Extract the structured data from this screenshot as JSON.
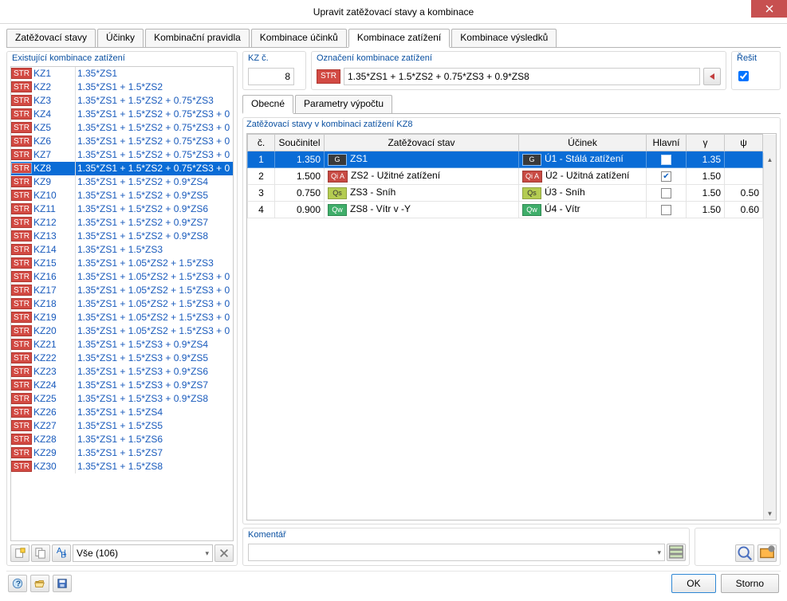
{
  "window": {
    "title": "Upravit zatěžovací stavy a kombinace"
  },
  "top_tabs": {
    "items": [
      "Zatěžovací stavy",
      "Účinky",
      "Kombinační pravidla",
      "Kombinace účinků",
      "Kombinace zatížení",
      "Kombinace výsledků"
    ],
    "active_index": 4
  },
  "left": {
    "group_label": "Existující kombinace zatížení",
    "badge_text": "STR",
    "selected_id": "KZ8",
    "combinations": [
      {
        "id": "KZ1",
        "formula": "1.35*ZS1"
      },
      {
        "id": "KZ2",
        "formula": "1.35*ZS1 + 1.5*ZS2"
      },
      {
        "id": "KZ3",
        "formula": "1.35*ZS1 + 1.5*ZS2 + 0.75*ZS3"
      },
      {
        "id": "KZ4",
        "formula": "1.35*ZS1 + 1.5*ZS2 + 0.75*ZS3 + 0"
      },
      {
        "id": "KZ5",
        "formula": "1.35*ZS1 + 1.5*ZS2 + 0.75*ZS3 + 0"
      },
      {
        "id": "KZ6",
        "formula": "1.35*ZS1 + 1.5*ZS2 + 0.75*ZS3 + 0"
      },
      {
        "id": "KZ7",
        "formula": "1.35*ZS1 + 1.5*ZS2 + 0.75*ZS3 + 0"
      },
      {
        "id": "KZ8",
        "formula": "1.35*ZS1 + 1.5*ZS2 + 0.75*ZS3 + 0"
      },
      {
        "id": "KZ9",
        "formula": "1.35*ZS1 + 1.5*ZS2 + 0.9*ZS4"
      },
      {
        "id": "KZ10",
        "formula": "1.35*ZS1 + 1.5*ZS2 + 0.9*ZS5"
      },
      {
        "id": "KZ11",
        "formula": "1.35*ZS1 + 1.5*ZS2 + 0.9*ZS6"
      },
      {
        "id": "KZ12",
        "formula": "1.35*ZS1 + 1.5*ZS2 + 0.9*ZS7"
      },
      {
        "id": "KZ13",
        "formula": "1.35*ZS1 + 1.5*ZS2 + 0.9*ZS8"
      },
      {
        "id": "KZ14",
        "formula": "1.35*ZS1 + 1.5*ZS3"
      },
      {
        "id": "KZ15",
        "formula": "1.35*ZS1 + 1.05*ZS2 + 1.5*ZS3"
      },
      {
        "id": "KZ16",
        "formula": "1.35*ZS1 + 1.05*ZS2 + 1.5*ZS3 + 0"
      },
      {
        "id": "KZ17",
        "formula": "1.35*ZS1 + 1.05*ZS2 + 1.5*ZS3 + 0"
      },
      {
        "id": "KZ18",
        "formula": "1.35*ZS1 + 1.05*ZS2 + 1.5*ZS3 + 0"
      },
      {
        "id": "KZ19",
        "formula": "1.35*ZS1 + 1.05*ZS2 + 1.5*ZS3 + 0"
      },
      {
        "id": "KZ20",
        "formula": "1.35*ZS1 + 1.05*ZS2 + 1.5*ZS3 + 0"
      },
      {
        "id": "KZ21",
        "formula": "1.35*ZS1 + 1.5*ZS3 + 0.9*ZS4"
      },
      {
        "id": "KZ22",
        "formula": "1.35*ZS1 + 1.5*ZS3 + 0.9*ZS5"
      },
      {
        "id": "KZ23",
        "formula": "1.35*ZS1 + 1.5*ZS3 + 0.9*ZS6"
      },
      {
        "id": "KZ24",
        "formula": "1.35*ZS1 + 1.5*ZS3 + 0.9*ZS7"
      },
      {
        "id": "KZ25",
        "formula": "1.35*ZS1 + 1.5*ZS3 + 0.9*ZS8"
      },
      {
        "id": "KZ26",
        "formula": "1.35*ZS1 + 1.5*ZS4"
      },
      {
        "id": "KZ27",
        "formula": "1.35*ZS1 + 1.5*ZS5"
      },
      {
        "id": "KZ28",
        "formula": "1.35*ZS1 + 1.5*ZS6"
      },
      {
        "id": "KZ29",
        "formula": "1.35*ZS1 + 1.5*ZS7"
      },
      {
        "id": "KZ30",
        "formula": "1.35*ZS1 + 1.5*ZS8"
      }
    ],
    "filter": {
      "label": "Vše (106)"
    }
  },
  "right": {
    "kz_num": {
      "label": "KZ č.",
      "value": "8"
    },
    "desc": {
      "label": "Označení kombinace zatížení",
      "badge": "STR",
      "value": "1.35*ZS1 + 1.5*ZS2 + 0.75*ZS3 + 0.9*ZS8"
    },
    "solve": {
      "label": "Řešit",
      "checked": true
    },
    "sub_tabs": {
      "items": [
        "Obecné",
        "Parametry výpočtu"
      ],
      "active_index": 0
    },
    "states": {
      "title": "Zatěžovací stavy v kombinaci zatížení KZ8",
      "headers": [
        "č.",
        "Součinitel",
        "Zatěžovací stav",
        "Účinek",
        "Hlavní",
        "γ",
        "ψ"
      ],
      "rows": [
        {
          "n": 1,
          "coef": "1.350",
          "badge": "G",
          "badge_class": "bg-G",
          "state": "ZS1",
          "eff_badge": "G",
          "eff_badge_class": "bg-G",
          "effect": "Ú1 - Stálá zatížení",
          "main": false,
          "gamma": "1.35",
          "psi": ""
        },
        {
          "n": 2,
          "coef": "1.500",
          "badge": "Qi A",
          "badge_class": "bg-QiA",
          "state": "ZS2 - Užitné zatížení",
          "eff_badge": "Qi A",
          "eff_badge_class": "bg-QiA",
          "effect": "Ú2 - Užitná zatížení",
          "main": true,
          "gamma": "1.50",
          "psi": ""
        },
        {
          "n": 3,
          "coef": "0.750",
          "badge": "Qs",
          "badge_class": "bg-Qs",
          "state": "ZS3 - Sníh",
          "eff_badge": "Qs",
          "eff_badge_class": "bg-Qs",
          "effect": "Ú3 - Sníh",
          "main": false,
          "gamma": "1.50",
          "psi": "0.50"
        },
        {
          "n": 4,
          "coef": "0.900",
          "badge": "Qw",
          "badge_class": "bg-Qw",
          "state": "ZS8 - Vítr v -Y",
          "eff_badge": "Qw",
          "eff_badge_class": "bg-Qw",
          "effect": "Ú4 - Vítr",
          "main": false,
          "gamma": "1.50",
          "psi": "0.60"
        }
      ],
      "selected_row": 0
    },
    "comment": {
      "label": "Komentář",
      "value": ""
    }
  },
  "footer": {
    "ok": "OK",
    "cancel": "Storno"
  }
}
